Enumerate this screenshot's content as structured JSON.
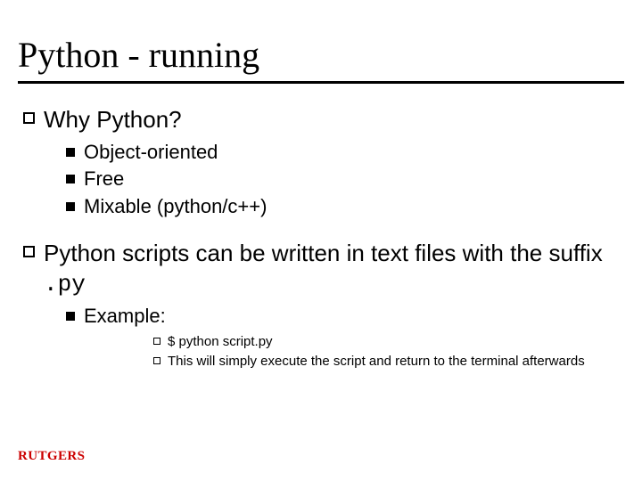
{
  "title": "Python - running",
  "points": [
    {
      "text": "Why Python?",
      "sub": [
        {
          "text": "Object-oriented"
        },
        {
          "text": "Free"
        },
        {
          "text": "Mixable (python/c++)"
        }
      ]
    },
    {
      "text": "Python scripts can be written in text files with the suffix",
      "suffix": ".py",
      "sub": [
        {
          "text": "Example:",
          "sub": [
            {
              "text": "$ python script.py"
            },
            {
              "text": "This will simply execute the script and return to the terminal afterwards"
            }
          ]
        }
      ]
    }
  ],
  "logo": "RUTGERS"
}
